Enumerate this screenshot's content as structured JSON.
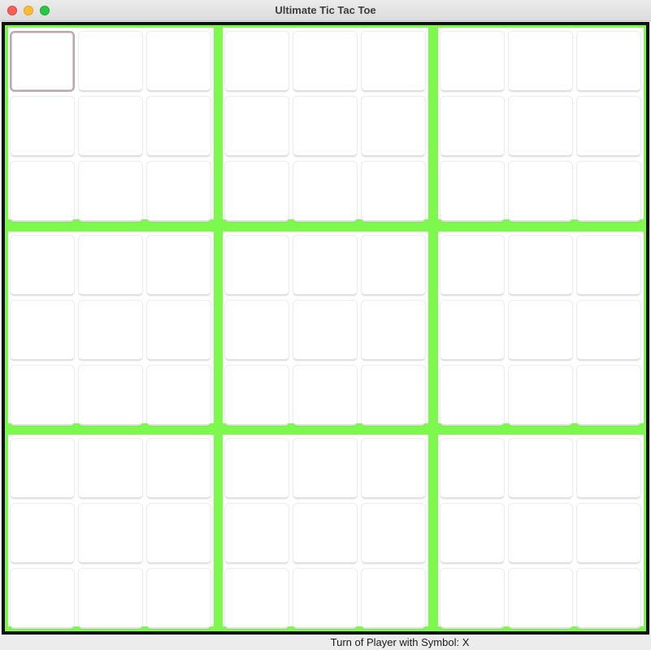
{
  "window": {
    "title": "Ultimate Tic Tac Toe"
  },
  "board": {
    "accent_color": "#7cf94c",
    "focused_cell": {
      "subboard": 0,
      "cell": 0
    },
    "subboards": [
      [
        "",
        "",
        "",
        "",
        "",
        "",
        "",
        "",
        ""
      ],
      [
        "",
        "",
        "",
        "",
        "",
        "",
        "",
        "",
        ""
      ],
      [
        "",
        "",
        "",
        "",
        "",
        "",
        "",
        "",
        ""
      ],
      [
        "",
        "",
        "",
        "",
        "",
        "",
        "",
        "",
        ""
      ],
      [
        "",
        "",
        "",
        "",
        "",
        "",
        "",
        "",
        ""
      ],
      [
        "",
        "",
        "",
        "",
        "",
        "",
        "",
        "",
        ""
      ],
      [
        "",
        "",
        "",
        "",
        "",
        "",
        "",
        "",
        ""
      ],
      [
        "",
        "",
        "",
        "",
        "",
        "",
        "",
        "",
        ""
      ],
      [
        "",
        "",
        "",
        "",
        "",
        "",
        "",
        "",
        ""
      ]
    ]
  },
  "status": {
    "text": "Turn of Player with Symbol: X"
  }
}
